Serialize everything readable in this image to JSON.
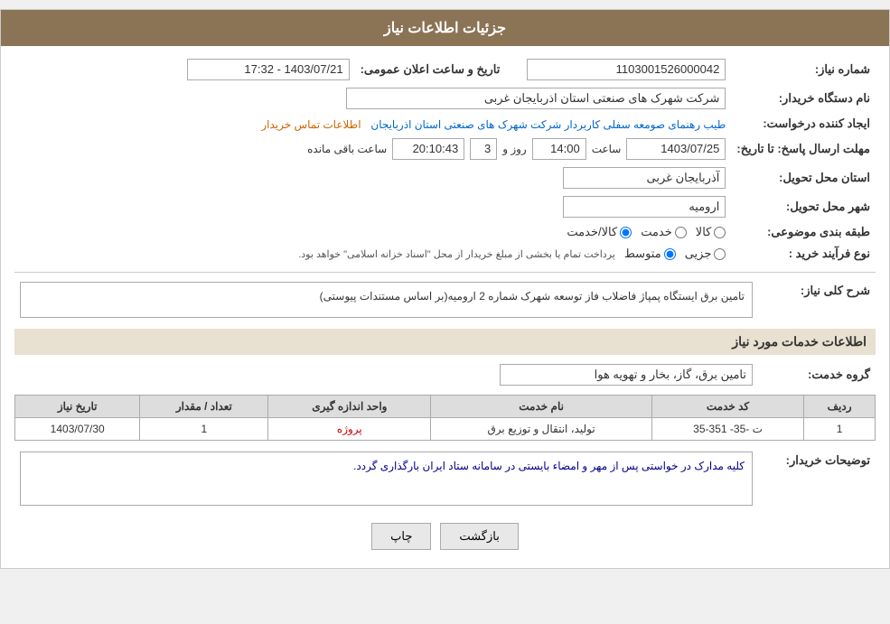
{
  "header": {
    "title": "جزئیات اطلاعات نیاز"
  },
  "fields": {
    "shomareNiaz": {
      "label": "شماره نیاز:",
      "value": "1103001526000042"
    },
    "namDastgah": {
      "label": "نام دستگاه خریدار:",
      "value": "شرکت شهرک های صنعتی استان اذربایجان غربی"
    },
    "ijadKonande": {
      "label": "ایجاد کننده درخواست:",
      "value": ""
    },
    "mohlat": {
      "label": "مهلت ارسال پاسخ: تا تاریخ:",
      "date": "1403/07/25",
      "saatLabel": "ساعت",
      "saat": "14:00",
      "roozLabel": "روز و",
      "rooz": "3",
      "baghimande": "20:10:43",
      "baghimandeLabel": "ساعت باقی مانده"
    },
    "tarikhElan": {
      "label": "تاریخ و ساعت اعلان عمومی:",
      "value": "1403/07/21 - 17:32"
    },
    "ostanTahvil": {
      "label": "استان محل تحویل:",
      "value": "آذربایجان غربی"
    },
    "shahrTahvil": {
      "label": "شهر محل تحویل:",
      "value": "ارومیه"
    },
    "tabagheBandi": {
      "label": "طبقه بندی موضوعی:",
      "options": [
        {
          "id": "kala",
          "label": "کالا"
        },
        {
          "id": "khedmat",
          "label": "خدمت"
        },
        {
          "id": "kala_khedmat",
          "label": "کالا/خدمت"
        }
      ],
      "selected": "kala_khedmat"
    },
    "noefarayand": {
      "label": "نوع فرآیند خرید :",
      "options": [
        {
          "id": "jozyi",
          "label": "جزیی"
        },
        {
          "id": "motavasset",
          "label": "متوسط"
        }
      ],
      "selected": "motavasset",
      "description": "پرداخت تمام یا بخشی از مبلغ خریدار از محل \"اسناد خزانه اسلامی\" خواهد بود."
    },
    "rahnamaLink": {
      "text": "طیب رهنمای صومعه سفلی کاربردار شرکت شهرک های صنعتی استان اذربایجان",
      "linkText": "اطلاعات تماس خریدار"
    },
    "sharh": {
      "label": "شرح کلی نیاز:",
      "value": "تامین برق ایستگاه پمپاژ فاضلاب فاز توسعه شهرک شماره 2 ارومیه(بر اساس مستندات پیوستی)"
    }
  },
  "servicesSection": {
    "title": "اطلاعات خدمات مورد نیاز",
    "groupLabel": "گروه خدمت:",
    "groupValue": "تامین برق، گاز، بخار و تهویه هوا",
    "tableHeaders": [
      "ردیف",
      "کد خدمت",
      "نام خدمت",
      "واحد اندازه گیری",
      "تعداد / مقدار",
      "تاریخ نیاز"
    ],
    "tableRows": [
      {
        "radif": "1",
        "kodKhedmat": "ت -35- 351-35",
        "namKhedmat": "تولید، انتقال و توزیع برق",
        "vahed": "پروژه",
        "tedad": "1",
        "tarikh": "1403/07/30"
      }
    ]
  },
  "notes": {
    "label": "توضیحات خریدار:",
    "value": "کلیه مدارک در خواستی پس از مهر و امضاء بایستی در سامانه ستاد ایران بارگذاری گردد."
  },
  "buttons": {
    "print": "چاپ",
    "back": "بازگشت"
  }
}
